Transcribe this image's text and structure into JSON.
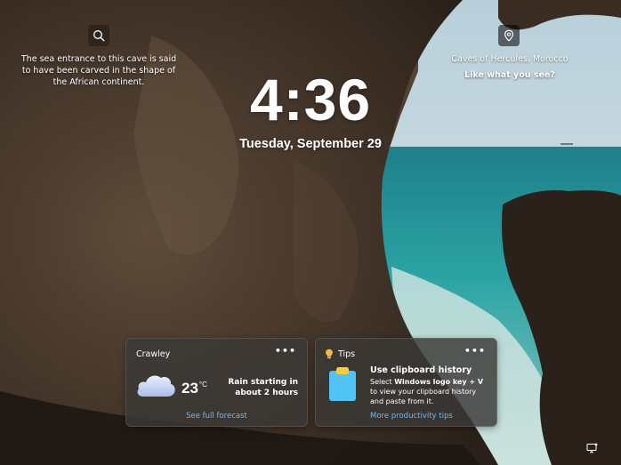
{
  "caption": {
    "left_text": "The sea entrance to this cave is said to have been carved in the shape of the African continent.",
    "location": "Caves of Hercules, Morocco",
    "like_prompt": "Like what you see?"
  },
  "clock": {
    "time": "4:36",
    "date": "Tuesday, September 29"
  },
  "weather": {
    "city": "Crawley",
    "more": "•••",
    "temperature": "23",
    "unit": "°C",
    "condition": "Rain starting in about 2 hours",
    "forecast_link": "See full forecast",
    "icon": "cloud-rain-icon"
  },
  "tips": {
    "title": "Tips",
    "more": "•••",
    "headline": "Use clipboard history",
    "body_pre": "Select ",
    "body_bold": "Windows logo key + V",
    "body_post": " to view your clipboard history and paste from it.",
    "link": "More productivity tips",
    "icon": "clipboard-icon"
  },
  "colors": {
    "link": "#6cb8ff",
    "card_bg": "#3a3836",
    "sea": "#2a9a9c",
    "sky": "#c9dce6"
  }
}
